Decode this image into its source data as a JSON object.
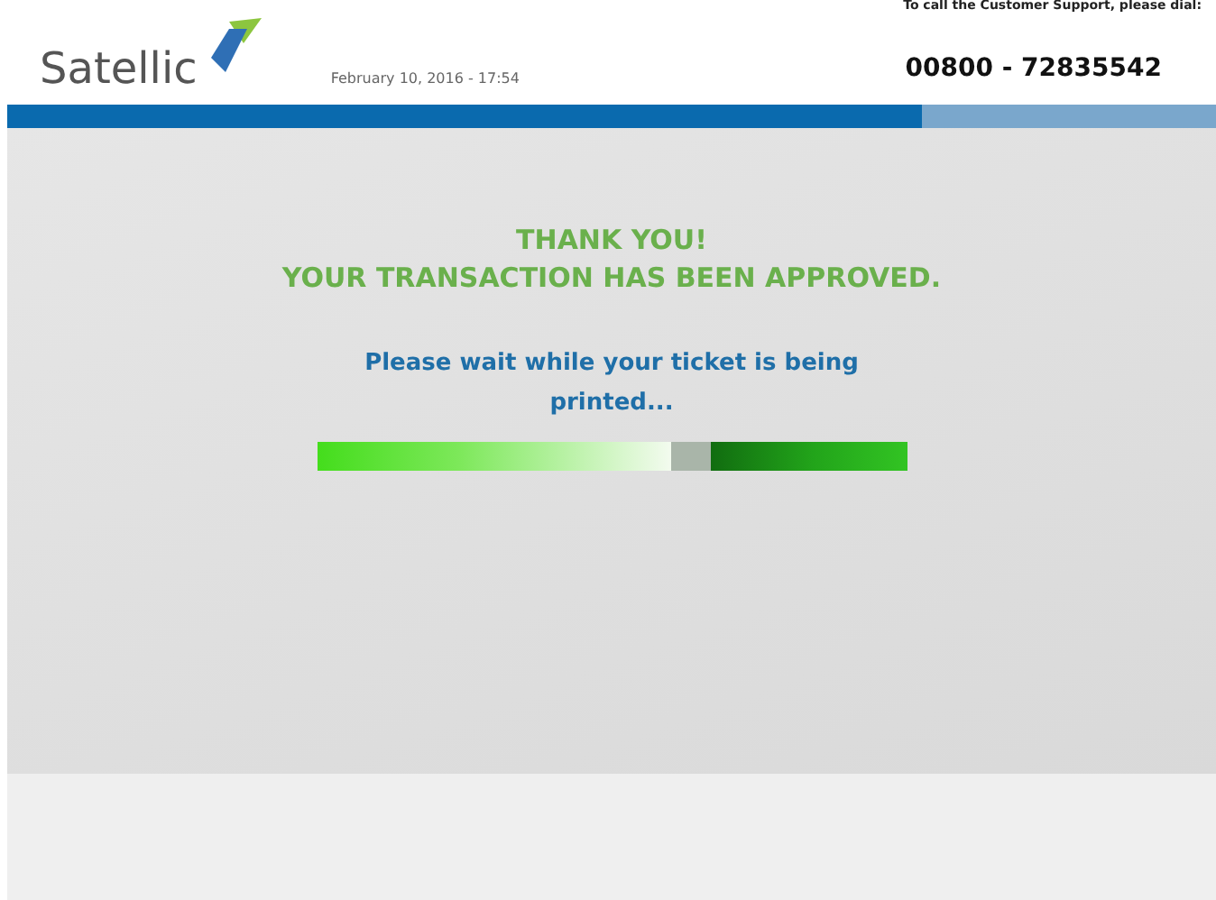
{
  "header": {
    "logo_text": "Satellic",
    "datetime": "February 10, 2016 - 17:54",
    "support_label": "To call the Customer Support, please dial:",
    "support_phone": "00800 - 72835542"
  },
  "message": {
    "title_lines": [
      "THANK YOU!",
      "YOUR TRANSACTION HAS BEEN APPROVED."
    ],
    "status": "Please wait while your ticket is being printed...",
    "progress": {
      "level": 0.6
    }
  }
}
